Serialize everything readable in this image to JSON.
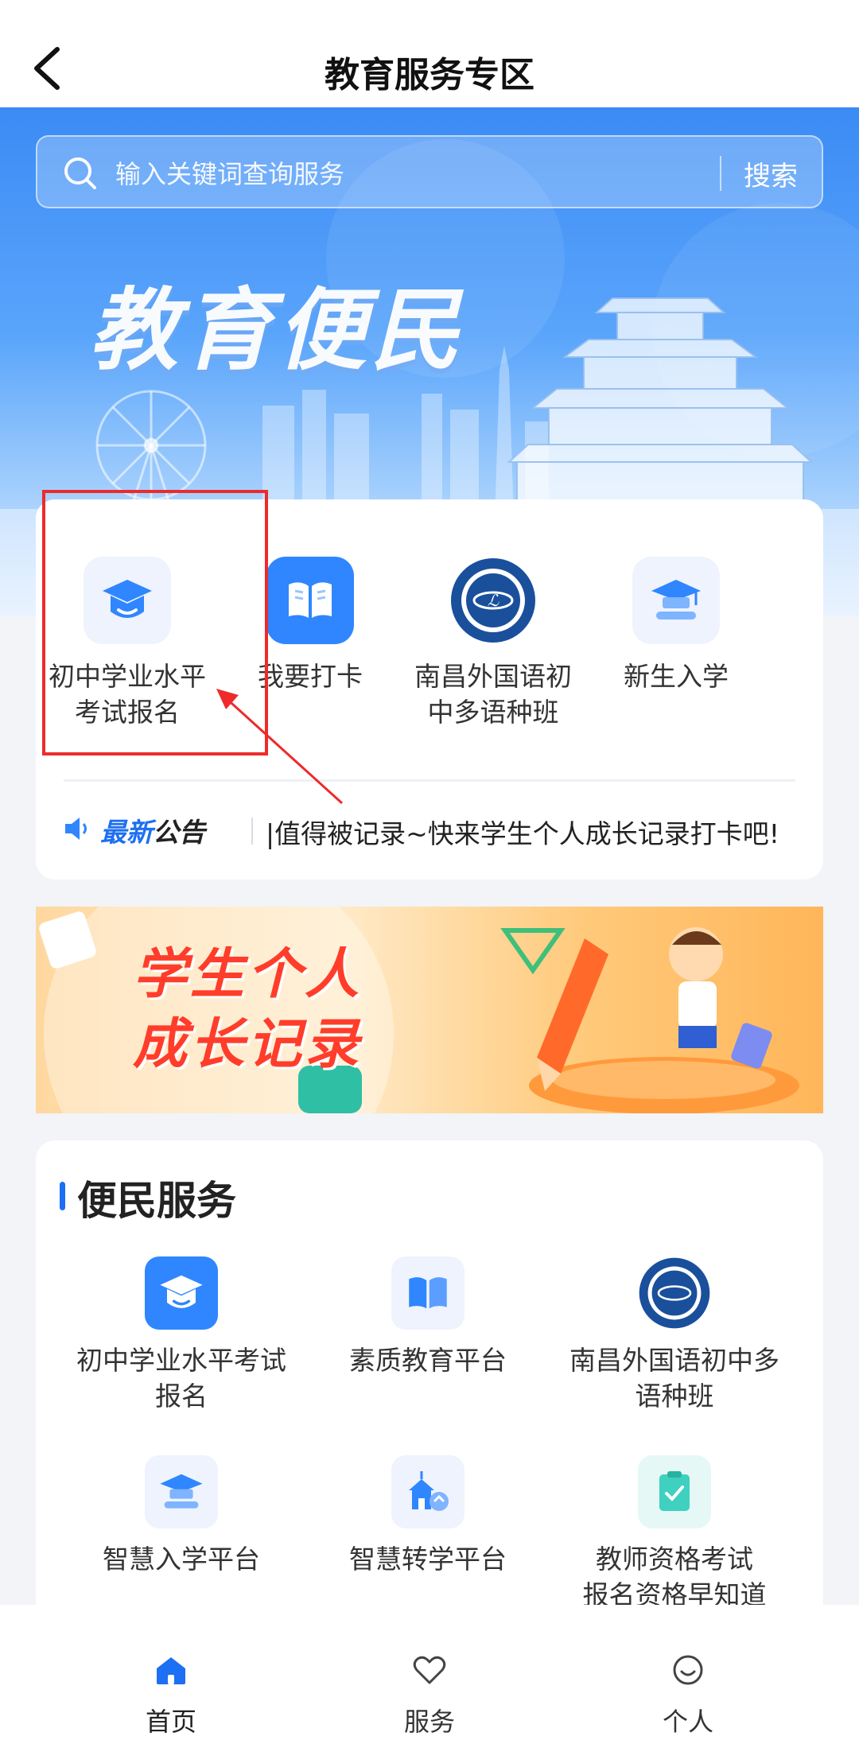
{
  "header": {
    "title": "教育服务专区"
  },
  "search": {
    "placeholder": "输入关键词查询服务",
    "button": "搜索"
  },
  "hero": {
    "title": "教育便民"
  },
  "quick_items": [
    {
      "label": "初中学业水平\n考试报名",
      "icon": "graduation-cap-icon"
    },
    {
      "label": "我要打卡",
      "icon": "open-book-icon"
    },
    {
      "label": "南昌外国语初\n中多语种班",
      "icon": "school-logo-icon"
    },
    {
      "label": "新生入学",
      "icon": "mortarboard-icon"
    }
  ],
  "notice": {
    "tag_part1": "最新",
    "tag_part2": "公告",
    "text": "|值得被记录~快来学生个人成长记录打卡吧!"
  },
  "banner": {
    "title_line1": "学生个人",
    "title_line2": "成长记录"
  },
  "services": {
    "title": "便民服务",
    "items": [
      {
        "label": "初中学业水平考试\n报名",
        "icon": "graduation-cap-icon"
      },
      {
        "label": "素质教育平台",
        "icon": "open-book-icon"
      },
      {
        "label": "南昌外国语初中多\n语种班",
        "icon": "school-logo-icon"
      },
      {
        "label": "智慧入学平台",
        "icon": "mortarboard-icon"
      },
      {
        "label": "智慧转学平台",
        "icon": "school-transfer-icon"
      },
      {
        "label": "教师资格考试\n报名资格早知道",
        "icon": "checklist-icon"
      }
    ]
  },
  "tabbar": {
    "items": [
      {
        "label": "首页",
        "icon": "home-icon",
        "active": true
      },
      {
        "label": "服务",
        "icon": "heart-icon",
        "active": false
      },
      {
        "label": "个人",
        "icon": "smile-icon",
        "active": false
      }
    ]
  },
  "colors": {
    "accent": "#1d6ff3",
    "highlight": "#ee2a2a",
    "hero_top": "#3b8bf5"
  }
}
